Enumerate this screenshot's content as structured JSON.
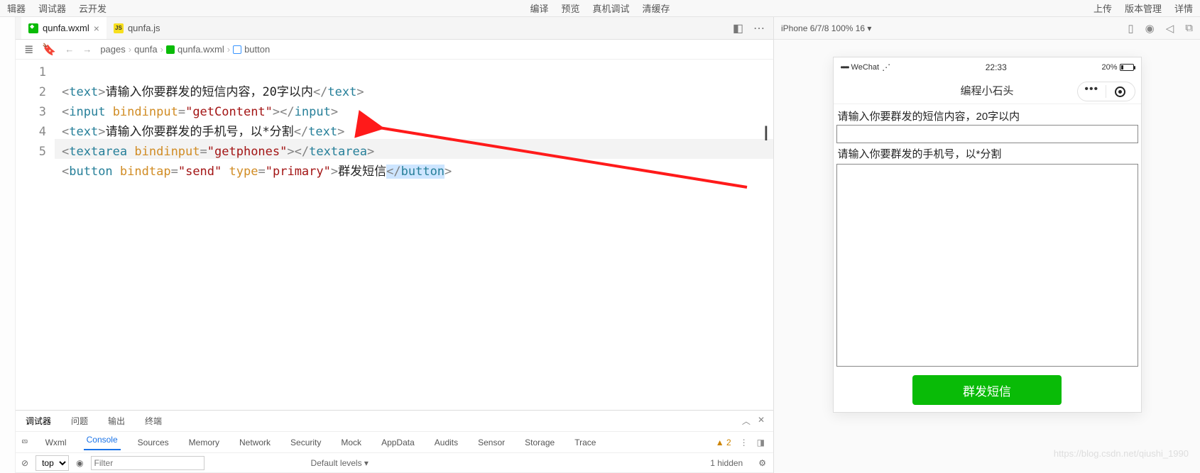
{
  "menubar": {
    "left": [
      "辑器",
      "调试器",
      "云开发"
    ],
    "center": [
      "编译",
      "预览",
      "真机调试",
      "清缓存"
    ],
    "right": [
      "上传",
      "版本管理",
      "详情"
    ]
  },
  "tabs": [
    {
      "name": "qunfa.wxml",
      "type": "wxml",
      "active": true,
      "closable": true
    },
    {
      "name": "qunfa.js",
      "type": "js",
      "active": false,
      "closable": false
    }
  ],
  "breadcrumb": {
    "parts": [
      "pages",
      "qunfa",
      "qunfa.wxml",
      "button"
    ]
  },
  "code": {
    "lines": [
      {
        "n": "1",
        "tag1": "text",
        "inner": "请输入你要群发的短信内容，20字以内",
        "tag2": "text"
      },
      {
        "n": "2",
        "tag1": "input",
        "attr": "bindinput",
        "val": "getContent",
        "tag2": "input"
      },
      {
        "n": "3",
        "tag1": "text",
        "inner": "请输入你要群发的手机号，以*分割",
        "tag2": "text"
      },
      {
        "n": "4",
        "tag1": "textarea",
        "attr": "bindinput",
        "val": "getphones",
        "tag2": "textarea"
      },
      {
        "n": "5",
        "tag1": "button",
        "attr": "bindtap",
        "val": "send",
        "attr2": "type",
        "val2": "primary",
        "inner": "群发短信",
        "tag2": "button"
      }
    ]
  },
  "devtools": {
    "topTabs": [
      "调试器",
      "问题",
      "输出",
      "终端"
    ],
    "subTabs": [
      "Wxml",
      "Console",
      "Sources",
      "Memory",
      "Network",
      "Security",
      "Mock",
      "AppData",
      "Audits",
      "Sensor",
      "Storage",
      "Trace"
    ],
    "subActive": "Console",
    "warnCount": "2",
    "filter": {
      "scope": "top",
      "placeholder": "Filter",
      "levels": "Default levels ▾",
      "hidden": "1 hidden"
    }
  },
  "simulator": {
    "device": "iPhone 6/7/8 100% 16 ▾",
    "status": {
      "carrier": "WeChat",
      "time": "22:33",
      "battery": "20%"
    },
    "navTitle": "编程小石头",
    "page": {
      "label1": "请输入你要群发的短信内容，20字以内",
      "label2": "请输入你要群发的手机号，以*分割",
      "button": "群发短信"
    }
  },
  "watermark": "https://blog.csdn.net/qiushi_1990"
}
